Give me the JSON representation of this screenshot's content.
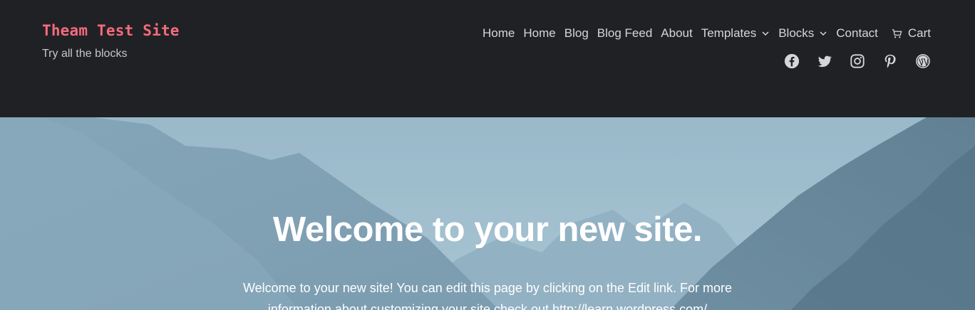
{
  "site": {
    "title": "Theam Test Site",
    "tagline": "Try all the blocks"
  },
  "nav": {
    "items": [
      {
        "label": "Home"
      },
      {
        "label": "Home"
      },
      {
        "label": "Blog"
      },
      {
        "label": "Blog Feed"
      },
      {
        "label": "About"
      },
      {
        "label": "Templates",
        "has_submenu": true
      },
      {
        "label": "Blocks",
        "has_submenu": true
      },
      {
        "label": "Contact"
      }
    ],
    "cart_label": "Cart",
    "cart_icon": "cart-icon",
    "submenu_icon": "chevron-down-icon"
  },
  "social": [
    {
      "name": "facebook-icon"
    },
    {
      "name": "twitter-icon"
    },
    {
      "name": "instagram-icon"
    },
    {
      "name": "pinterest-icon"
    },
    {
      "name": "wordpress-icon"
    }
  ],
  "hero": {
    "title": "Welcome to your new site.",
    "text_before": "Welcome to your new site! You can edit this page by clicking on the Edit link. For more information about customizing your site check out ",
    "link_text": "http://learn.wordpress.com/"
  },
  "colors": {
    "header_bg": "#202124",
    "site_title": "#f46b7e",
    "nav_text": "#d4d6d8",
    "hero_text": "#ffffff"
  }
}
